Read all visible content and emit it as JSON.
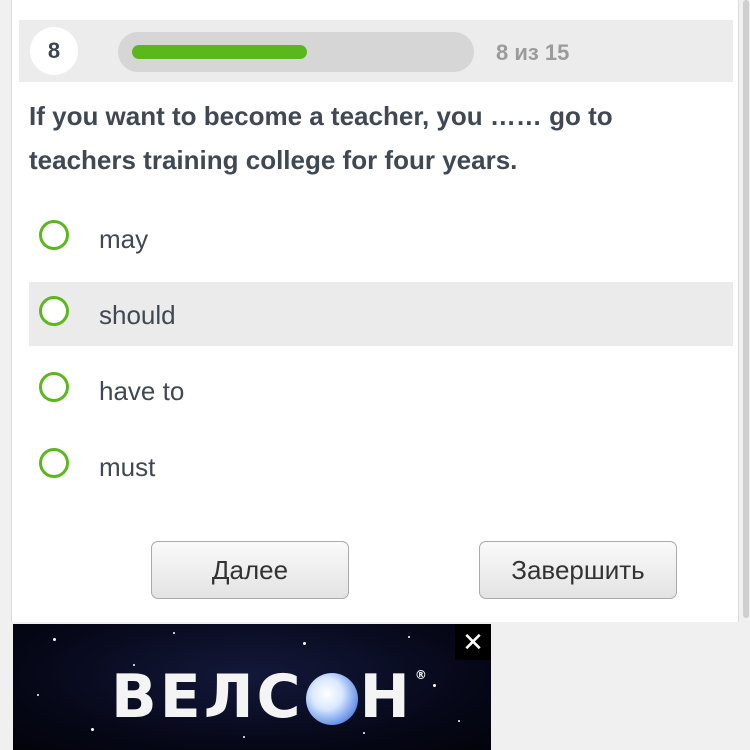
{
  "quiz": {
    "number": "8",
    "progress_text": "8 из 15",
    "progress_fraction": 0.533,
    "accent_color": "#5bb71c",
    "question": "If you want to become a teacher, you …… go to teachers training college for four years.",
    "options": [
      {
        "label": "may"
      },
      {
        "label": "should"
      },
      {
        "label": "have to"
      },
      {
        "label": "must"
      }
    ],
    "next_label": "Далее",
    "finish_label": "Завершить"
  },
  "ad": {
    "logo_text": "ВЕЛСОН",
    "close_icon": "close-icon"
  }
}
